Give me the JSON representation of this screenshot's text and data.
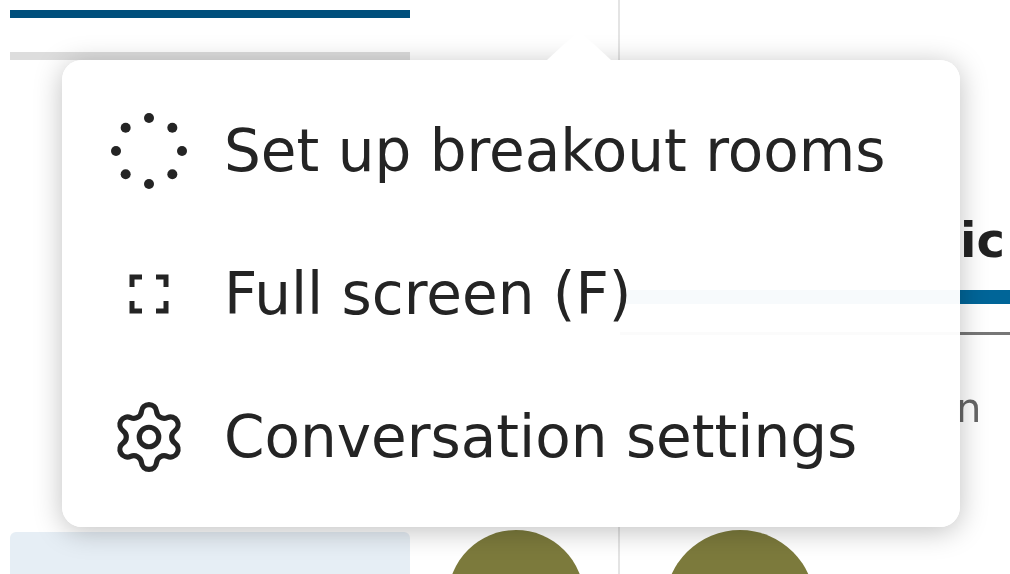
{
  "progress": {
    "level": 1
  },
  "panel": {
    "heading": "ic",
    "filter": "n"
  },
  "menu": {
    "items": [
      {
        "kind": "breakout",
        "label": "Set up breakout rooms"
      },
      {
        "kind": "fullscreen",
        "label": "Full screen (F)"
      },
      {
        "kind": "settings",
        "label": "Conversation settings"
      }
    ]
  }
}
